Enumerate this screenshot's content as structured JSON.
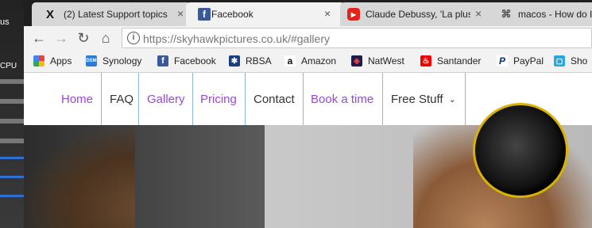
{
  "desktop": {
    "top_label": "us",
    "cpu_label": "CPU"
  },
  "tabs": [
    {
      "title": "(2) Latest Support topics",
      "icon": "x-icon",
      "active": false
    },
    {
      "title": "Facebook",
      "icon": "facebook-icon",
      "active": true
    },
    {
      "title": "Claude Debussy, 'La plus",
      "icon": "youtube-icon",
      "active": false
    },
    {
      "title": "macos - How do I",
      "icon": "command-icon",
      "active": false
    }
  ],
  "toolbar": {
    "url_host": "https://skyhawkpictures.co.uk",
    "url_path": "/#gallery"
  },
  "bookmarks": [
    {
      "label": "Apps",
      "icon": "apps-grid-icon"
    },
    {
      "label": "Synology",
      "icon": "synology-icon"
    },
    {
      "label": "Facebook",
      "icon": "facebook-icon"
    },
    {
      "label": "RBSA",
      "icon": "rbsa-icon"
    },
    {
      "label": "Amazon",
      "icon": "amazon-icon"
    },
    {
      "label": "NatWest",
      "icon": "natwest-icon"
    },
    {
      "label": "Santander",
      "icon": "santander-icon"
    },
    {
      "label": "PayPal",
      "icon": "paypal-icon"
    },
    {
      "label": "Sho",
      "icon": "shop-icon"
    }
  ],
  "site_nav": [
    {
      "label": "Home"
    },
    {
      "label": "FAQ"
    },
    {
      "label": "Gallery"
    },
    {
      "label": "Pricing"
    },
    {
      "label": "Contact"
    },
    {
      "label": "Book a time"
    },
    {
      "label": "Free Stuff"
    }
  ],
  "colors": {
    "nav_accent": "#9c46d9",
    "nav_divider": "#8fb8d8",
    "tabstrip": "#1f1f1f"
  }
}
